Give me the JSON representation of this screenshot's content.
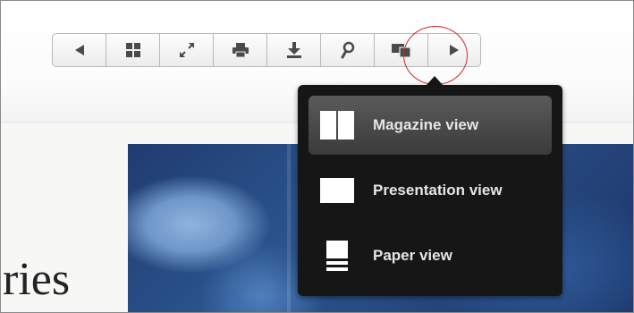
{
  "toolbar": {
    "buttons": [
      {
        "name": "previous-page-button",
        "icon": "left-triangle-icon"
      },
      {
        "name": "thumbnails-button",
        "icon": "grid-icon"
      },
      {
        "name": "fullscreen-button",
        "icon": "expand-arrows-icon"
      },
      {
        "name": "print-button",
        "icon": "printer-icon"
      },
      {
        "name": "download-button",
        "icon": "download-icon"
      },
      {
        "name": "search-button",
        "icon": "magnifier-icon"
      },
      {
        "name": "view-mode-button",
        "icon": "view-mode-icon",
        "active": true
      },
      {
        "name": "next-page-button",
        "icon": "right-triangle-icon"
      }
    ],
    "icon_color": "#4a4a4a"
  },
  "view_menu": {
    "items": [
      {
        "label": "Magazine view",
        "icon": "magazine-view-icon",
        "selected": true
      },
      {
        "label": "Presentation view",
        "icon": "presentation-view-icon",
        "selected": false
      },
      {
        "label": "Paper view",
        "icon": "paper-view-icon",
        "selected": false
      }
    ]
  },
  "document": {
    "title_fragment": "ries"
  },
  "colors": {
    "highlight_circle": "#d8262a",
    "menu_background": "#161616",
    "menu_text": "#e6e6e6"
  }
}
